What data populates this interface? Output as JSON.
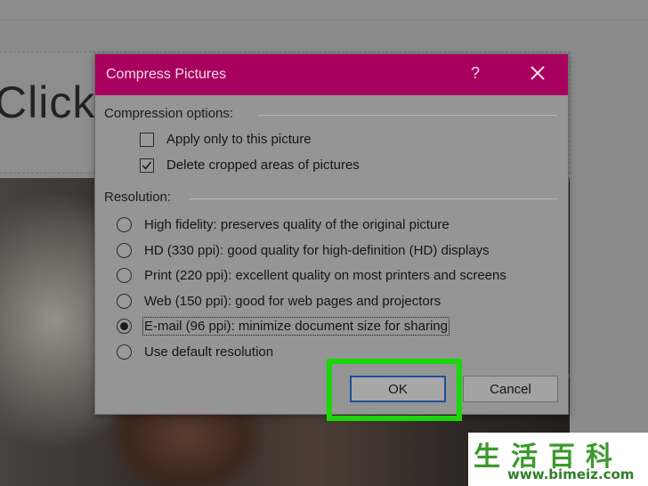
{
  "slide": {
    "title_placeholder": "Click to add title"
  },
  "dialog": {
    "title": "Compress Pictures",
    "help_label": "?",
    "compression_section_label": "Compression options:",
    "compression_options": [
      {
        "label": "Apply only to this picture",
        "checked": false
      },
      {
        "label": "Delete cropped areas of pictures",
        "checked": true
      }
    ],
    "resolution_section_label": "Resolution:",
    "resolution_options": [
      {
        "label": "High fidelity: preserves quality of the original picture",
        "selected": false
      },
      {
        "label": "HD (330 ppi): good quality for high-definition (HD) displays",
        "selected": false
      },
      {
        "label": "Print (220 ppi): excellent quality on most printers and screens",
        "selected": false
      },
      {
        "label": "Web (150 ppi): good for web pages and projectors",
        "selected": false
      },
      {
        "label": "E-mail (96 ppi): minimize document size for sharing",
        "selected": true
      },
      {
        "label": "Use default resolution",
        "selected": false
      }
    ],
    "ok_label": "OK",
    "cancel_label": "Cancel"
  },
  "watermark": {
    "chars": "生活百科",
    "url": "www.bimeiz.com"
  },
  "colors": {
    "titlebar": "#a8005f",
    "highlight": "#1bd60a",
    "ok_border": "#1d4f9a"
  },
  "icons": {
    "close": "close-icon",
    "checkmark": "checkmark-icon"
  }
}
